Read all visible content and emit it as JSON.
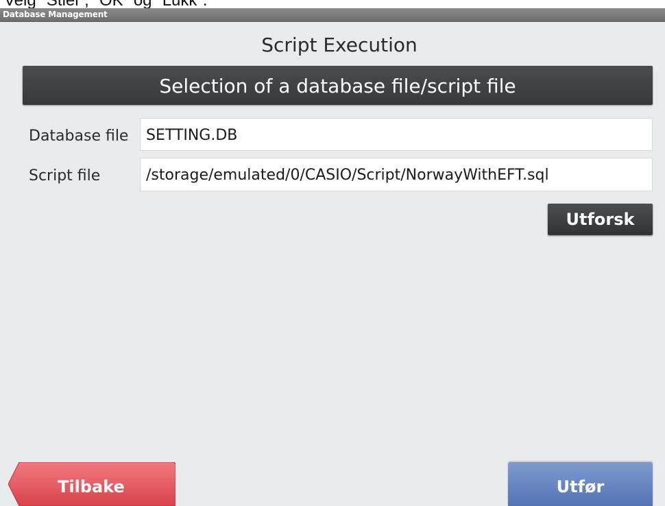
{
  "top_crop_text": "Velg \"Stiel\", \"OK\" og \"Lukk\".",
  "window": {
    "title": "Database Management"
  },
  "page": {
    "heading": "Script Execution",
    "section_title": "Selection of a database file/script file"
  },
  "fields": {
    "database_file": {
      "label": "Database file",
      "value": "SETTING.DB"
    },
    "script_file": {
      "label": "Script file",
      "value": "/storage/emulated/0/CASIO/Script/NorwayWithEFT.sql"
    }
  },
  "buttons": {
    "explore": "Utforsk",
    "back": "Tilbake",
    "execute": "Utfør"
  },
  "colors": {
    "background": "#e9ebed",
    "section_bar": "#3f4144",
    "back_button": "#e8585f",
    "execute_button": "#6a89c6"
  }
}
